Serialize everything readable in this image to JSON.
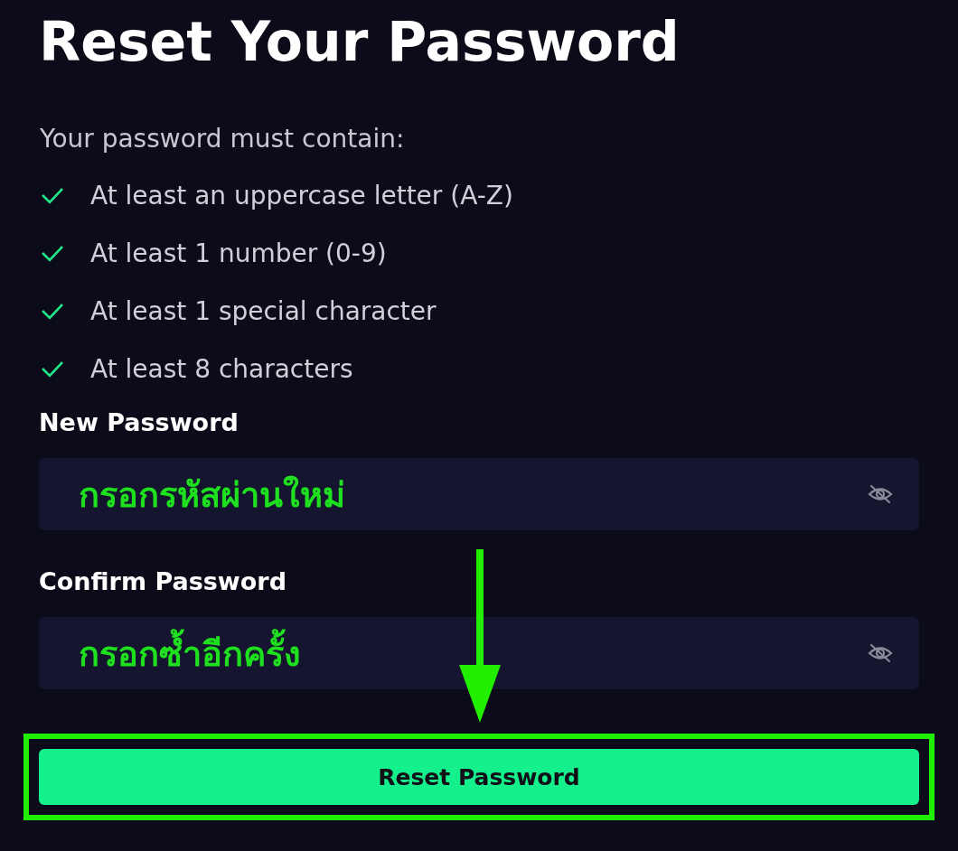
{
  "title": "Reset Your Password",
  "requirements_heading": "Your password must contain:",
  "requirements": [
    {
      "text": "At least an uppercase letter (A-Z)",
      "met": true
    },
    {
      "text": "At least 1 number (0-9)",
      "met": true
    },
    {
      "text": "At least 1 special character",
      "met": true
    },
    {
      "text": "At least 8 characters",
      "met": true
    }
  ],
  "fields": [
    {
      "label": "New Password",
      "annotation": "กรอกรหัสผ่านใหม่"
    },
    {
      "label": "Confirm Password",
      "annotation": "กรอกซ้ำอีกครั้ง"
    }
  ],
  "button": {
    "label": "Reset Password",
    "highlighted": true
  }
}
